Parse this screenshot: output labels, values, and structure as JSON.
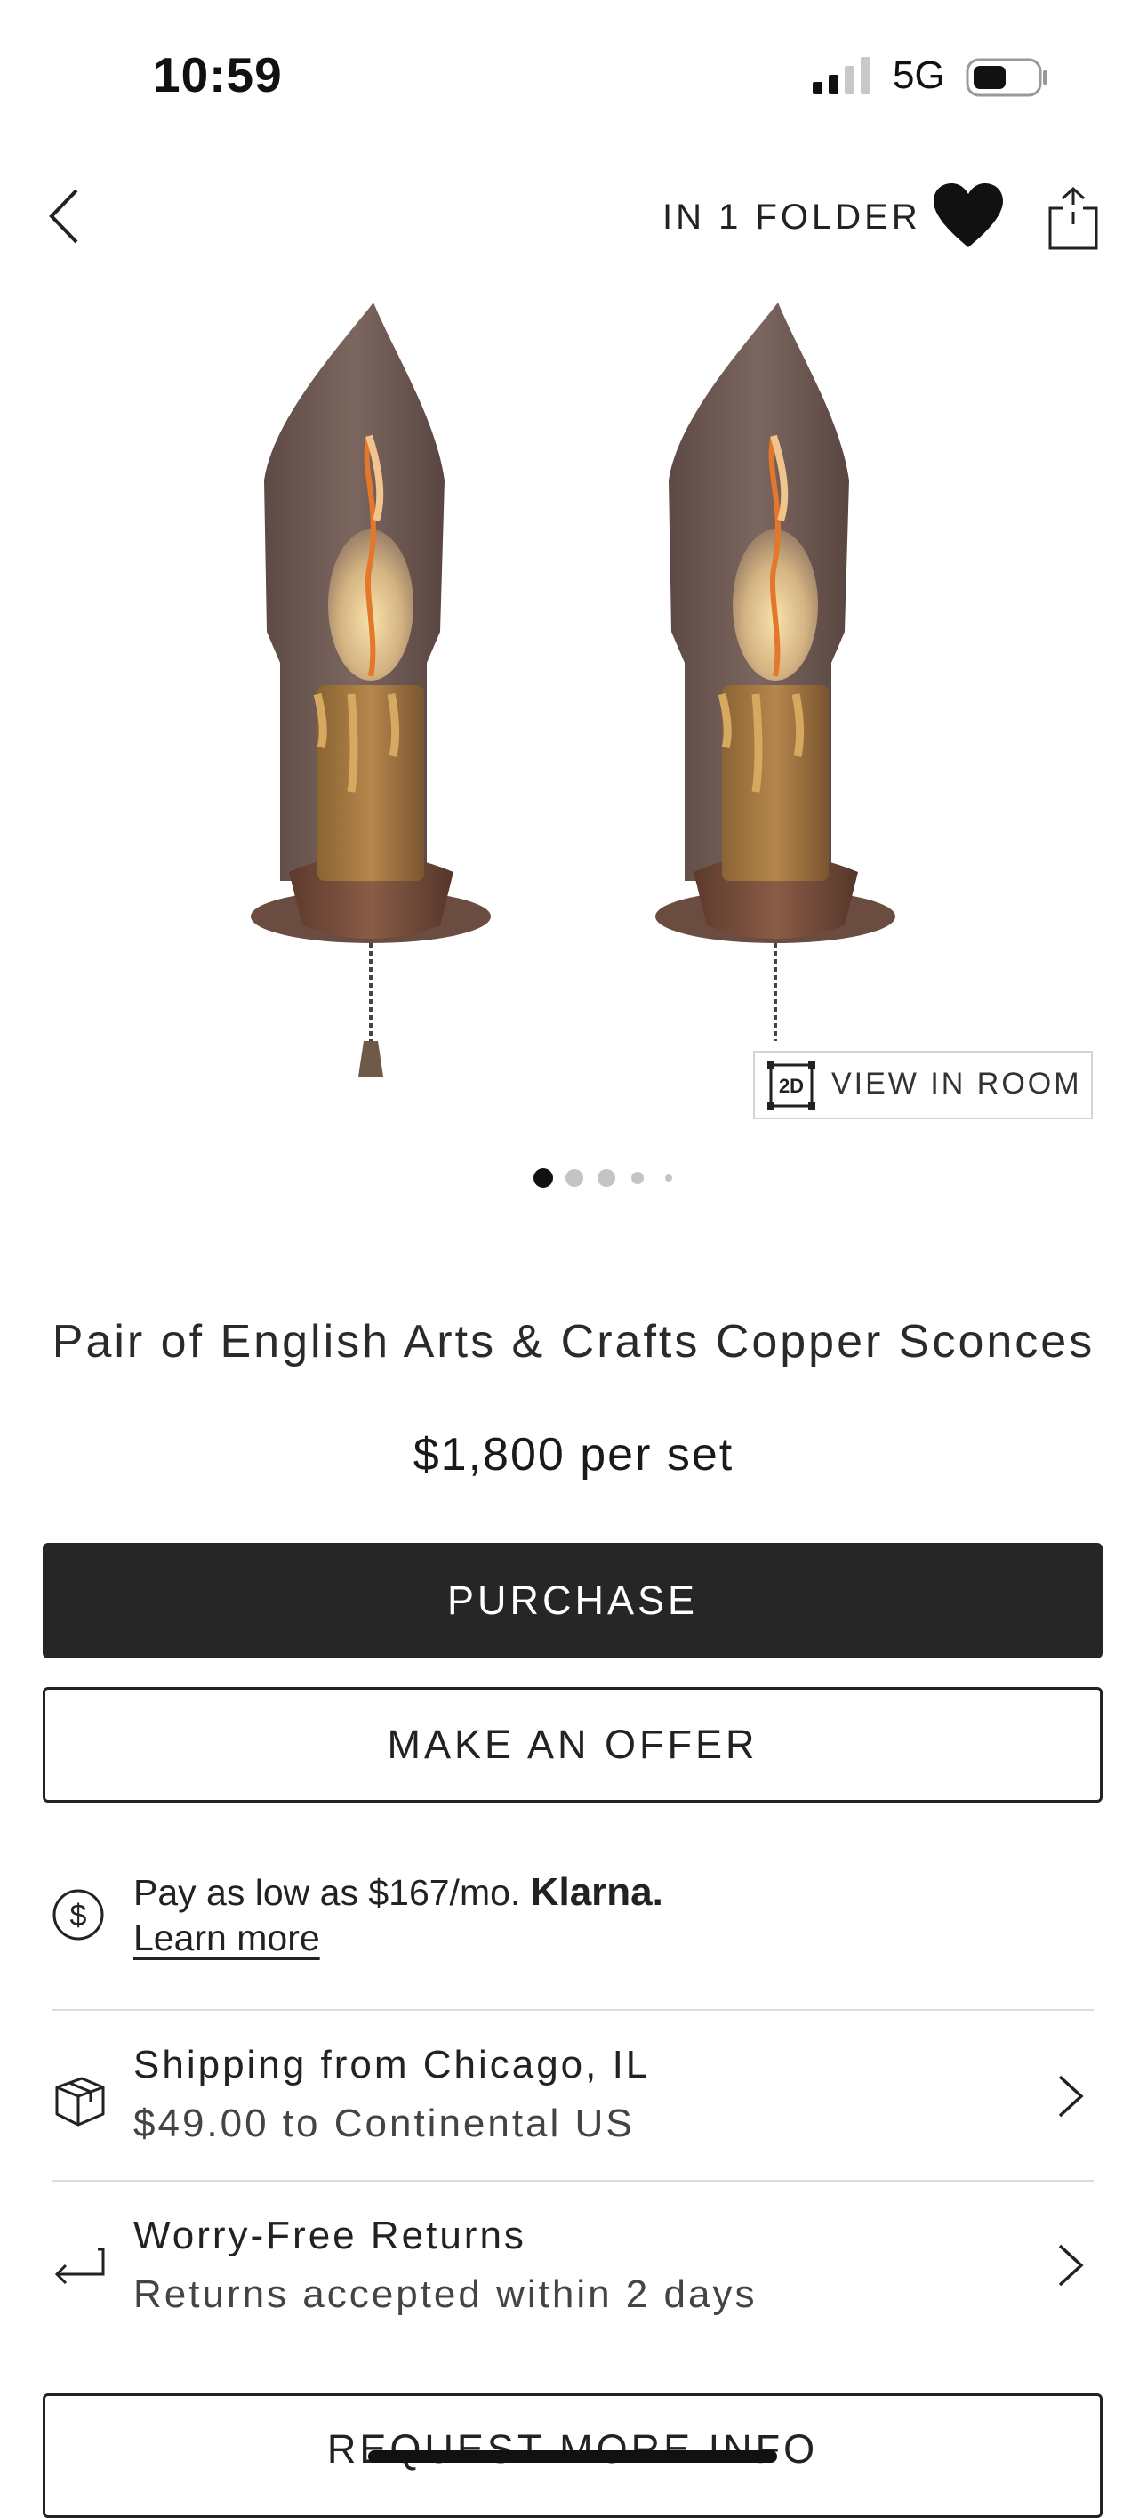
{
  "status_bar": {
    "time": "10:59",
    "network": "5G"
  },
  "nav": {
    "folder_label": "IN 1 FOLDER",
    "icons": [
      "back-chevron-icon",
      "heart-icon",
      "share-icon"
    ]
  },
  "gallery": {
    "image_alt": "pair of copper candle sconces",
    "view_in_room_badge": "2D",
    "view_in_room_label": "VIEW IN ROOM",
    "page_count": 5,
    "active_page": 1
  },
  "product": {
    "title": "Pair of English Arts & Crafts Copper Sconces",
    "price": "$1,800 per set"
  },
  "actions": {
    "purchase": "PURCHASE",
    "make_offer": "MAKE AN OFFER",
    "request_info": "REQUEST MORE INFO"
  },
  "financing": {
    "text": "Pay as low as $167/mo.",
    "brand": "Klarna.",
    "link": "Learn more"
  },
  "shipping": {
    "title": "Shipping from Chicago, IL",
    "subtitle": "$49.00 to Continental US"
  },
  "returns": {
    "title": "Worry-Free Returns",
    "subtitle": "Returns accepted within 2 days"
  },
  "colors": {
    "primary_button": "#262626",
    "text": "#222222",
    "divider": "#dcdcdc"
  }
}
